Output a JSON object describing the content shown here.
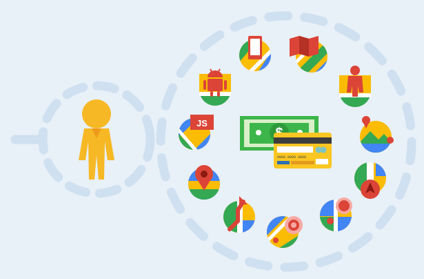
{
  "illustration": {
    "person": {
      "icon": "person-icon",
      "color": "#f6b824"
    },
    "payment": {
      "cash_icon": "banknote-icon",
      "cash_symbol": "$",
      "card_icon": "credit-card-icon",
      "card_number": "0000 0000 0000"
    },
    "orbit_icons": [
      {
        "name": "mobile-phone-map-icon"
      },
      {
        "name": "folded-map-icon"
      },
      {
        "name": "business-person-map-icon"
      },
      {
        "name": "landscape-pin-icon"
      },
      {
        "name": "navigation-arrow-map-icon"
      },
      {
        "name": "location-dots-map-icon"
      },
      {
        "name": "target-map-icon"
      },
      {
        "name": "route-arrow-map-icon"
      },
      {
        "name": "map-pin-icon"
      },
      {
        "name": "javascript-map-icon",
        "label": "JS"
      },
      {
        "name": "android-robot-map-icon"
      }
    ],
    "colors": {
      "background": "#e8f0f8",
      "dashes": "#cfe0f0",
      "map_green": "#34a853",
      "map_yellow": "#fbbc05",
      "map_blue": "#4285f4",
      "map_red": "#db4437",
      "money_green": "#3cb64a",
      "card_yellow": "#f9c623"
    }
  }
}
